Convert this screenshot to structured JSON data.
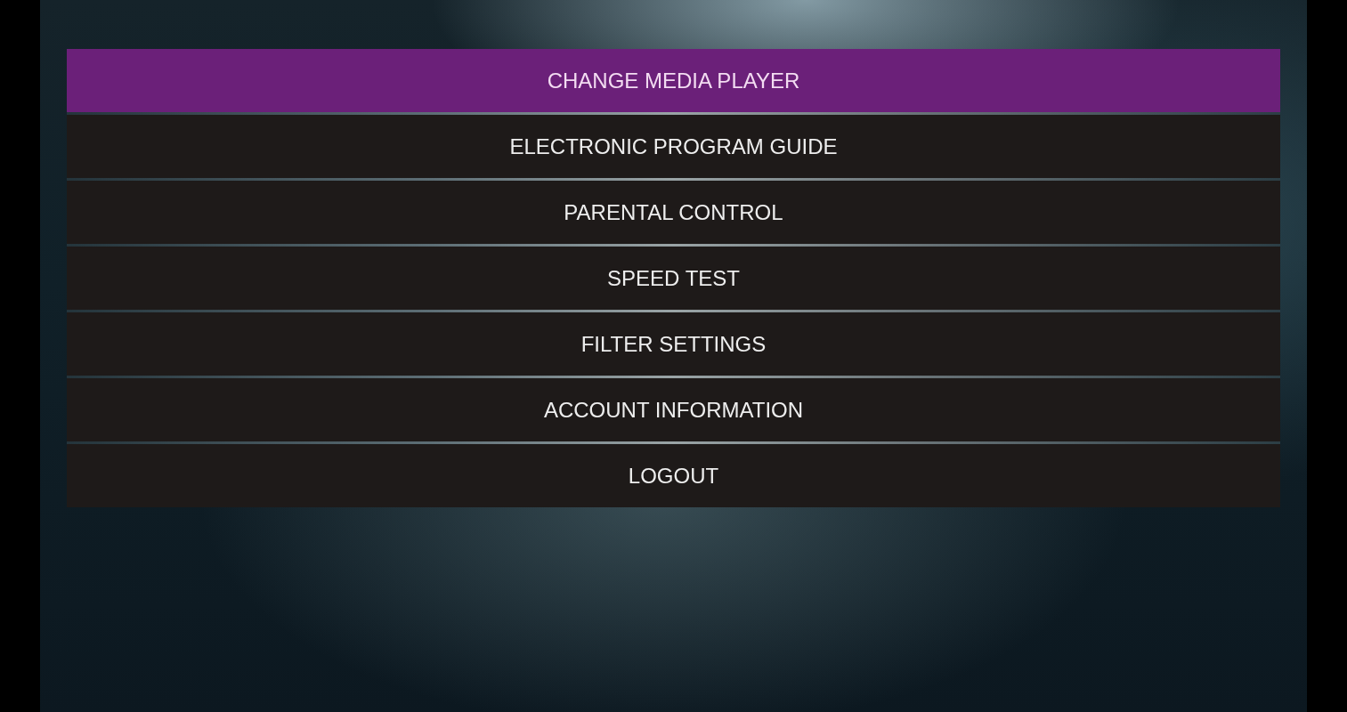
{
  "menu": {
    "items": [
      {
        "label": "CHANGE MEDIA PLAYER",
        "selected": true
      },
      {
        "label": "ELECTRONIC PROGRAM GUIDE",
        "selected": false
      },
      {
        "label": "PARENTAL CONTROL",
        "selected": false
      },
      {
        "label": "SPEED TEST",
        "selected": false
      },
      {
        "label": "FILTER SETTINGS",
        "selected": false
      },
      {
        "label": "ACCOUNT INFORMATION",
        "selected": false
      },
      {
        "label": "LOGOUT",
        "selected": false
      }
    ]
  }
}
